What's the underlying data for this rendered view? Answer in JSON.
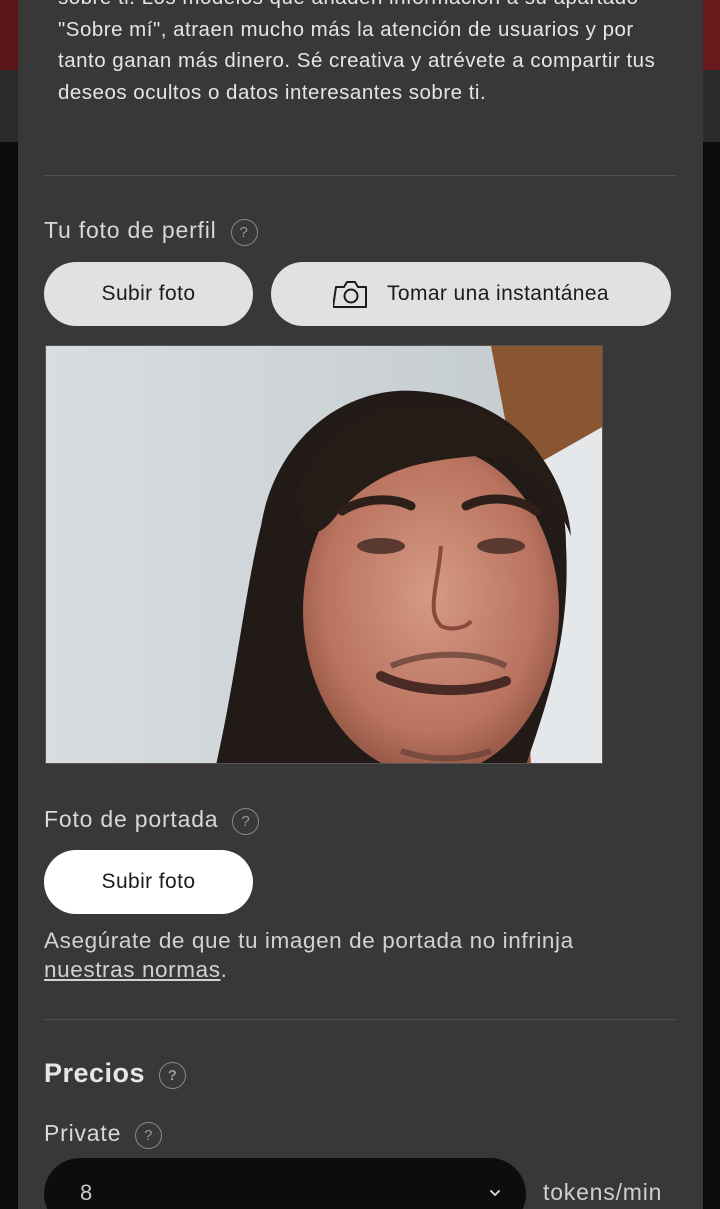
{
  "about": {
    "text": "sobre ti. Los modelos que añaden información a su apartado \"Sobre mí\", atraen mucho más la atención de usuarios y por tanto ganan más dinero. Sé creativa y atrévete a compartir tus deseos ocultos o datos interesantes sobre ti."
  },
  "profile_photo": {
    "label": "Tu foto de perfil",
    "help": "?",
    "upload_label": "Subir foto",
    "snapshot_label": "Tomar una instantánea",
    "snapshot_icon": "camera-icon"
  },
  "cover_photo": {
    "label": "Foto de portada",
    "help": "?",
    "upload_label": "Subir foto",
    "notice_prefix": "Asegúrate de que tu imagen de portada no infrinja ",
    "notice_link": "nuestras normas",
    "notice_suffix": "."
  },
  "pricing": {
    "title": "Precios",
    "help": "?",
    "private_label": "Private",
    "private_help": "?",
    "private_value": "8",
    "unit": "tokens/min"
  },
  "colors": {
    "modal_bg": "#383838",
    "button_gray": "#e1e1e1",
    "button_white": "#ffffff",
    "select_bg": "#0d0d0d"
  }
}
